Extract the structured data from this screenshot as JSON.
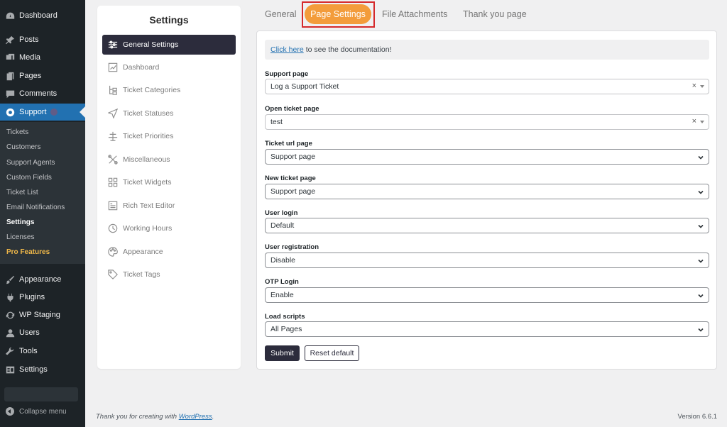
{
  "wp_menu": {
    "items": [
      {
        "label": "Dashboard",
        "icon": "dashboard-icon"
      },
      {
        "label": "Posts",
        "icon": "pin-icon"
      },
      {
        "label": "Media",
        "icon": "media-icon"
      },
      {
        "label": "Pages",
        "icon": "pages-icon"
      },
      {
        "label": "Comments",
        "icon": "comments-icon"
      },
      {
        "label": "Support",
        "icon": "lifebuoy-icon"
      },
      {
        "label": "Appearance",
        "icon": "brush-icon"
      },
      {
        "label": "Plugins",
        "icon": "plug-icon"
      },
      {
        "label": "WP Staging",
        "icon": "refresh-icon"
      },
      {
        "label": "Users",
        "icon": "user-icon"
      },
      {
        "label": "Tools",
        "icon": "wrench-icon"
      },
      {
        "label": "Settings",
        "icon": "settings-icon"
      }
    ],
    "submenu": [
      "Tickets",
      "Customers",
      "Support Agents",
      "Custom Fields",
      "Ticket List",
      "Email Notifications",
      "Settings",
      "Licenses",
      "Pro Features"
    ],
    "collapse_label": "Collapse menu"
  },
  "settings_panel": {
    "title": "Settings",
    "items": [
      {
        "label": "General Settings",
        "icon": "sliders-icon"
      },
      {
        "label": "Dashboard",
        "icon": "chart-icon"
      },
      {
        "label": "Ticket Categories",
        "icon": "tree-icon"
      },
      {
        "label": "Ticket Statuses",
        "icon": "send-icon"
      },
      {
        "label": "Ticket Priorities",
        "icon": "priority-icon"
      },
      {
        "label": "Miscellaneous",
        "icon": "tools-icon"
      },
      {
        "label": "Ticket Widgets",
        "icon": "widgets-icon"
      },
      {
        "label": "Rich Text Editor",
        "icon": "editor-icon"
      },
      {
        "label": "Working Hours",
        "icon": "clock-icon"
      },
      {
        "label": "Appearance",
        "icon": "palette-icon"
      },
      {
        "label": "Ticket Tags",
        "icon": "tag-icon"
      }
    ]
  },
  "tabs": [
    "General",
    "Page Settings",
    "File Attachments",
    "Thank you page"
  ],
  "notice": {
    "link": "Click here",
    "text": "to see the documentation!"
  },
  "fields": [
    {
      "label": "Support page",
      "value": "Log a Support Ticket"
    },
    {
      "label": "Open ticket page",
      "value": "test"
    },
    {
      "label": "Ticket url page",
      "value": "Support page"
    },
    {
      "label": "New ticket page",
      "value": "Support page"
    },
    {
      "label": "User login",
      "value": "Default"
    },
    {
      "label": "User registration",
      "value": "Disable"
    },
    {
      "label": "OTP Login",
      "value": "Enable"
    },
    {
      "label": "Load scripts",
      "value": "All Pages"
    }
  ],
  "buttons": {
    "submit": "Submit",
    "reset": "Reset default"
  },
  "footer": {
    "text": "Thank you for creating with",
    "link": "WordPress",
    "period": ".",
    "version": "Version 6.6.1"
  },
  "colors": {
    "accent": "#f39c3b",
    "wp_blue": "#2271b1",
    "dark": "#2c2c3c"
  }
}
